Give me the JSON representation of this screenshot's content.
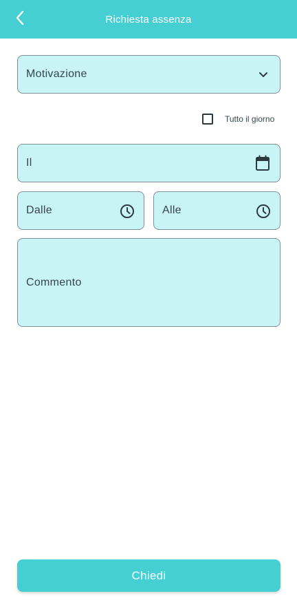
{
  "theme": {
    "accent": "#45cfd3",
    "field_bg": "#c9f4f6",
    "field_border": "#7f8f96"
  },
  "header": {
    "title": "Richiesta assenza",
    "back_icon": "chevron-left-icon"
  },
  "form": {
    "reason": {
      "placeholder": "Motivazione",
      "icon": "chevron-down-icon"
    },
    "all_day": {
      "label": "Tutto il giorno",
      "checked": false
    },
    "date": {
      "placeholder": "Il",
      "icon": "calendar-icon"
    },
    "from_time": {
      "placeholder": "Dalle",
      "icon": "clock-icon"
    },
    "to_time": {
      "placeholder": "Alle",
      "icon": "clock-icon"
    },
    "comment": {
      "placeholder": "Commento"
    }
  },
  "actions": {
    "submit_label": "Chiedi"
  }
}
